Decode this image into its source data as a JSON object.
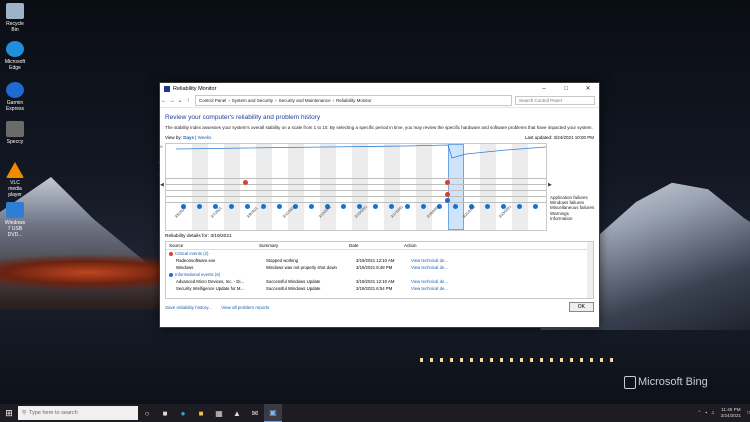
{
  "desktop_icons": [
    {
      "label": "Recycle Bin",
      "color": "#9fb3c8"
    },
    {
      "label": "Microsoft Edge",
      "color": "#1f8fdc"
    },
    {
      "label": "Garmin Express",
      "color": "#1d6ad0"
    },
    {
      "label": "Speccy",
      "color": "#6b6b6b"
    },
    {
      "label": "VLC media player",
      "color": "#f08a00"
    },
    {
      "label": "Windows 7 USB DVD...",
      "color": "#2d7fd6"
    }
  ],
  "watermark": "Microsoft Bing",
  "window": {
    "title": "Reliability Monitor",
    "address_parts": [
      "Control Panel",
      "System and Security",
      "Security and Maintenance",
      "Reliability Monitor"
    ],
    "search_placeholder": "Search Control Panel",
    "heading": "Review your computer's reliability and problem history",
    "description": "The stability index assesses your system's overall stability on a scale from 1 to 10. By selecting a specific period in time, you may review the specific hardware and software problems that have impacted your system.",
    "view_by_label": "View by:",
    "view_days": "Days",
    "view_sep": "|",
    "view_weeks": "Weeks",
    "last_updated": "Last updated: 3/24/2021 10:00 PM",
    "chart": {
      "y_labels": [
        "10",
        "5",
        "1"
      ],
      "dates": [
        "3/5/2021",
        "3/7/2021",
        "3/9/2021",
        "3/11/2021",
        "3/13/2021",
        "3/15/2021",
        "3/17/2021",
        "3/19/2021",
        "3/21/2021",
        "3/23/2021"
      ],
      "legend": [
        "Application failures",
        "Windows failures",
        "Miscellaneous failures",
        "Warnings",
        "Information"
      ]
    },
    "details_title": "Reliability details for: 3/19/2021",
    "columns": [
      "Source",
      "Summary",
      "Date",
      "Action"
    ],
    "critical_group": "Critical events (2)",
    "critical_rows": [
      {
        "source": "Radeonsoftware.exe",
        "summary": "Stopped working",
        "date": "3/19/2021 12:10 AM",
        "action": "View technical de..."
      },
      {
        "source": "Windows",
        "summary": "Windows was not properly shut down",
        "date": "3/19/2021 8:48 PM",
        "action": "View technical de..."
      }
    ],
    "info_group": "Informational events (6)",
    "info_rows": [
      {
        "source": "Advanced Micro Devices, Inc. - Di...",
        "summary": "Successful Windows Update",
        "date": "3/19/2021 12:10 AM",
        "action": "View technical de..."
      },
      {
        "source": "Security Intelligence Update for M...",
        "summary": "Successful Windows Update",
        "date": "3/19/2021 6:54 PM",
        "action": "View technical de..."
      }
    ],
    "save_history": "Save reliability history...",
    "view_all": "View all problem reports",
    "ok": "OK"
  },
  "taskbar": {
    "search_placeholder": "Type here to search",
    "time": "11:45 PM",
    "date": "3/24/2021"
  }
}
